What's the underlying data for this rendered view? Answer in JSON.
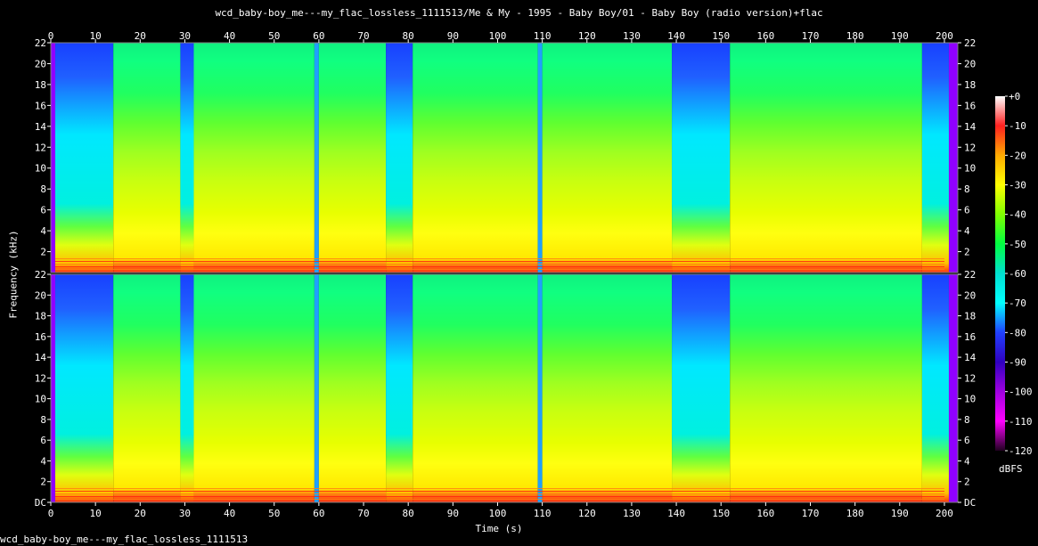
{
  "title": "wcd_baby-boy_me---my_flac_lossless_1111513/Me & My - 1995 - Baby Boy/01 - Baby Boy (radio version)+flac",
  "footer": "wcd_baby-boy_me---my_flac_lossless_1111513",
  "chart_data": {
    "type": "heatmap",
    "subtype": "spectrogram",
    "channels": 2,
    "xlabel": "Time (s)",
    "ylabel": "Frequency (kHz)",
    "xlim": [
      0,
      203
    ],
    "x_ticks": [
      0,
      10,
      20,
      30,
      40,
      50,
      60,
      70,
      80,
      90,
      100,
      110,
      120,
      130,
      140,
      150,
      160,
      170,
      180,
      190,
      200
    ],
    "ylim": [
      0,
      22
    ],
    "y_tick_labels": [
      "DC",
      "2",
      "4",
      "6",
      "8",
      "10",
      "12",
      "14",
      "16",
      "18",
      "20",
      "22"
    ],
    "colorbar": {
      "label": "dBFS",
      "range": [
        -120,
        0
      ],
      "ticks": [
        "+0",
        "-10",
        "-20",
        "-30",
        "-40",
        "-50",
        "-60",
        "-70",
        "-80",
        "-90",
        "-100",
        "-110",
        "-120"
      ],
      "colors": [
        "#ffffff",
        "#ff2020",
        "#ffaa00",
        "#ffff00",
        "#80ff00",
        "#00ff40",
        "#00e0d0",
        "#00ffff",
        "#2040ff",
        "#3000c0",
        "#a000e0",
        "#ff00ff",
        "#200020"
      ]
    },
    "sections": [
      {
        "t": [
          0,
          1
        ],
        "level": "silence"
      },
      {
        "t": [
          1,
          14
        ],
        "level": "quiet",
        "note": "blue/cyan above ~5 kHz"
      },
      {
        "t": [
          14,
          29
        ],
        "level": "loud"
      },
      {
        "t": [
          29,
          32
        ],
        "level": "quiet"
      },
      {
        "t": [
          32,
          59
        ],
        "level": "loud"
      },
      {
        "t": [
          59,
          60
        ],
        "level": "dip"
      },
      {
        "t": [
          60,
          75
        ],
        "level": "loud"
      },
      {
        "t": [
          75,
          81
        ],
        "level": "quiet"
      },
      {
        "t": [
          81,
          109
        ],
        "level": "loud"
      },
      {
        "t": [
          109,
          110
        ],
        "level": "dip"
      },
      {
        "t": [
          110,
          139
        ],
        "level": "loud"
      },
      {
        "t": [
          139,
          152
        ],
        "level": "quiet"
      },
      {
        "t": [
          152,
          195
        ],
        "level": "loud"
      },
      {
        "t": [
          195,
          201
        ],
        "level": "fade-out"
      },
      {
        "t": [
          201,
          203
        ],
        "level": "silence"
      }
    ]
  }
}
